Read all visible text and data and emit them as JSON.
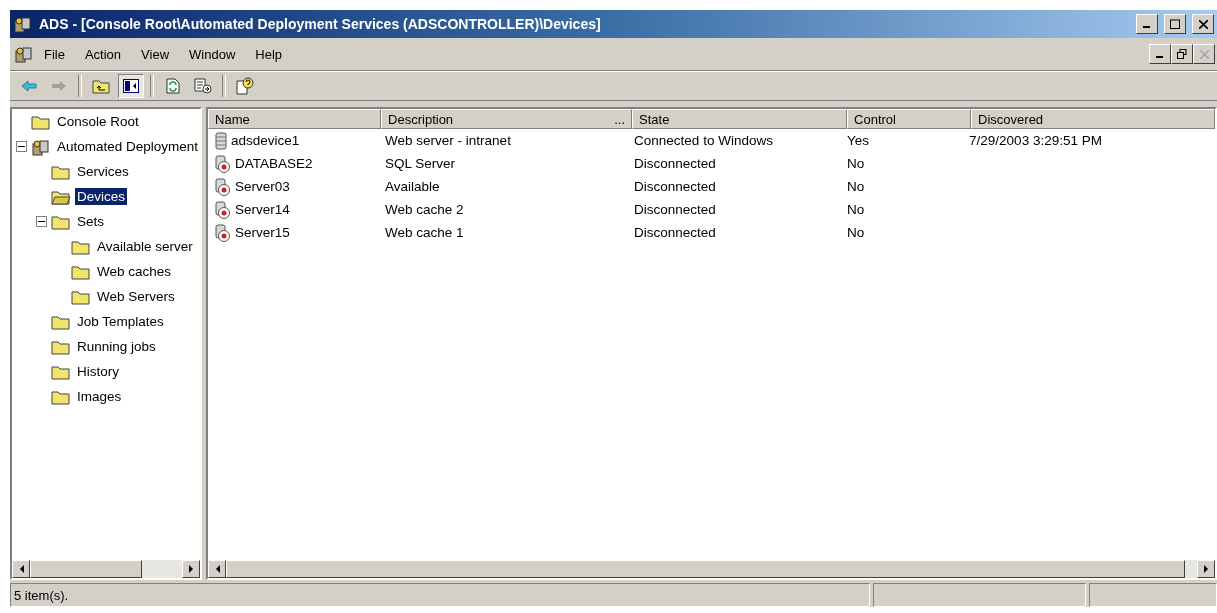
{
  "window": {
    "title": "ADS - [Console Root\\Automated Deployment Services (ADSCONTROLLER)\\Devices]"
  },
  "menu": [
    "File",
    "Action",
    "View",
    "Window",
    "Help"
  ],
  "toolbar": [
    {
      "kind": "back",
      "pressed": false
    },
    {
      "kind": "forward",
      "pressed": false
    },
    {
      "kind": "sep"
    },
    {
      "kind": "up",
      "pressed": false
    },
    {
      "kind": "pane",
      "pressed": true
    },
    {
      "kind": "sep"
    },
    {
      "kind": "refresh",
      "pressed": false
    },
    {
      "kind": "export",
      "pressed": false
    },
    {
      "kind": "sep"
    },
    {
      "kind": "help",
      "pressed": false
    }
  ],
  "tree": [
    {
      "label": "Console Root",
      "kind": "folder",
      "selected": false,
      "children": [
        {
          "label": "Automated Deployment",
          "kind": "ads",
          "selected": false,
          "expanded": true,
          "children": [
            {
              "label": "Services",
              "kind": "folder",
              "selected": false
            },
            {
              "label": "Devices",
              "kind": "open-folder",
              "selected": true
            },
            {
              "label": "Sets",
              "kind": "folder",
              "selected": false,
              "expanded": true,
              "children": [
                {
                  "label": "Available server",
                  "kind": "folder",
                  "selected": false
                },
                {
                  "label": "Web caches",
                  "kind": "folder",
                  "selected": false
                },
                {
                  "label": "Web Servers",
                  "kind": "folder",
                  "selected": false
                }
              ]
            },
            {
              "label": "Job Templates",
              "kind": "folder",
              "selected": false
            },
            {
              "label": "Running jobs",
              "kind": "folder",
              "selected": false
            },
            {
              "label": "History",
              "kind": "folder",
              "selected": false
            },
            {
              "label": "Images",
              "kind": "folder",
              "selected": false
            }
          ]
        }
      ]
    }
  ],
  "table": {
    "columns": [
      {
        "label": "Name"
      },
      {
        "label": "Description",
        "more": "..."
      },
      {
        "label": "State"
      },
      {
        "label": "Control"
      },
      {
        "label": "Discovered"
      }
    ],
    "rows": [
      {
        "kind": "connected",
        "cells": [
          "adsdevice1",
          "Web server - intranet",
          "Connected to Windows",
          "Yes",
          "7/29/2003 3:29:51 PM"
        ]
      },
      {
        "kind": "disconnected",
        "cells": [
          "DATABASE2",
          "SQL Server",
          "Disconnected",
          "No"
        ]
      },
      {
        "kind": "disconnected",
        "cells": [
          "Server03",
          "Available",
          "Disconnected",
          "No"
        ]
      },
      {
        "kind": "disconnected",
        "cells": [
          "Server14",
          "Web cache 2",
          "Disconnected",
          "No"
        ]
      },
      {
        "kind": "disconnected",
        "cells": [
          "Server15",
          "Web cache 1",
          "Disconnected",
          "No"
        ]
      }
    ]
  },
  "status_bar": {
    "text": "5 item(s)."
  }
}
